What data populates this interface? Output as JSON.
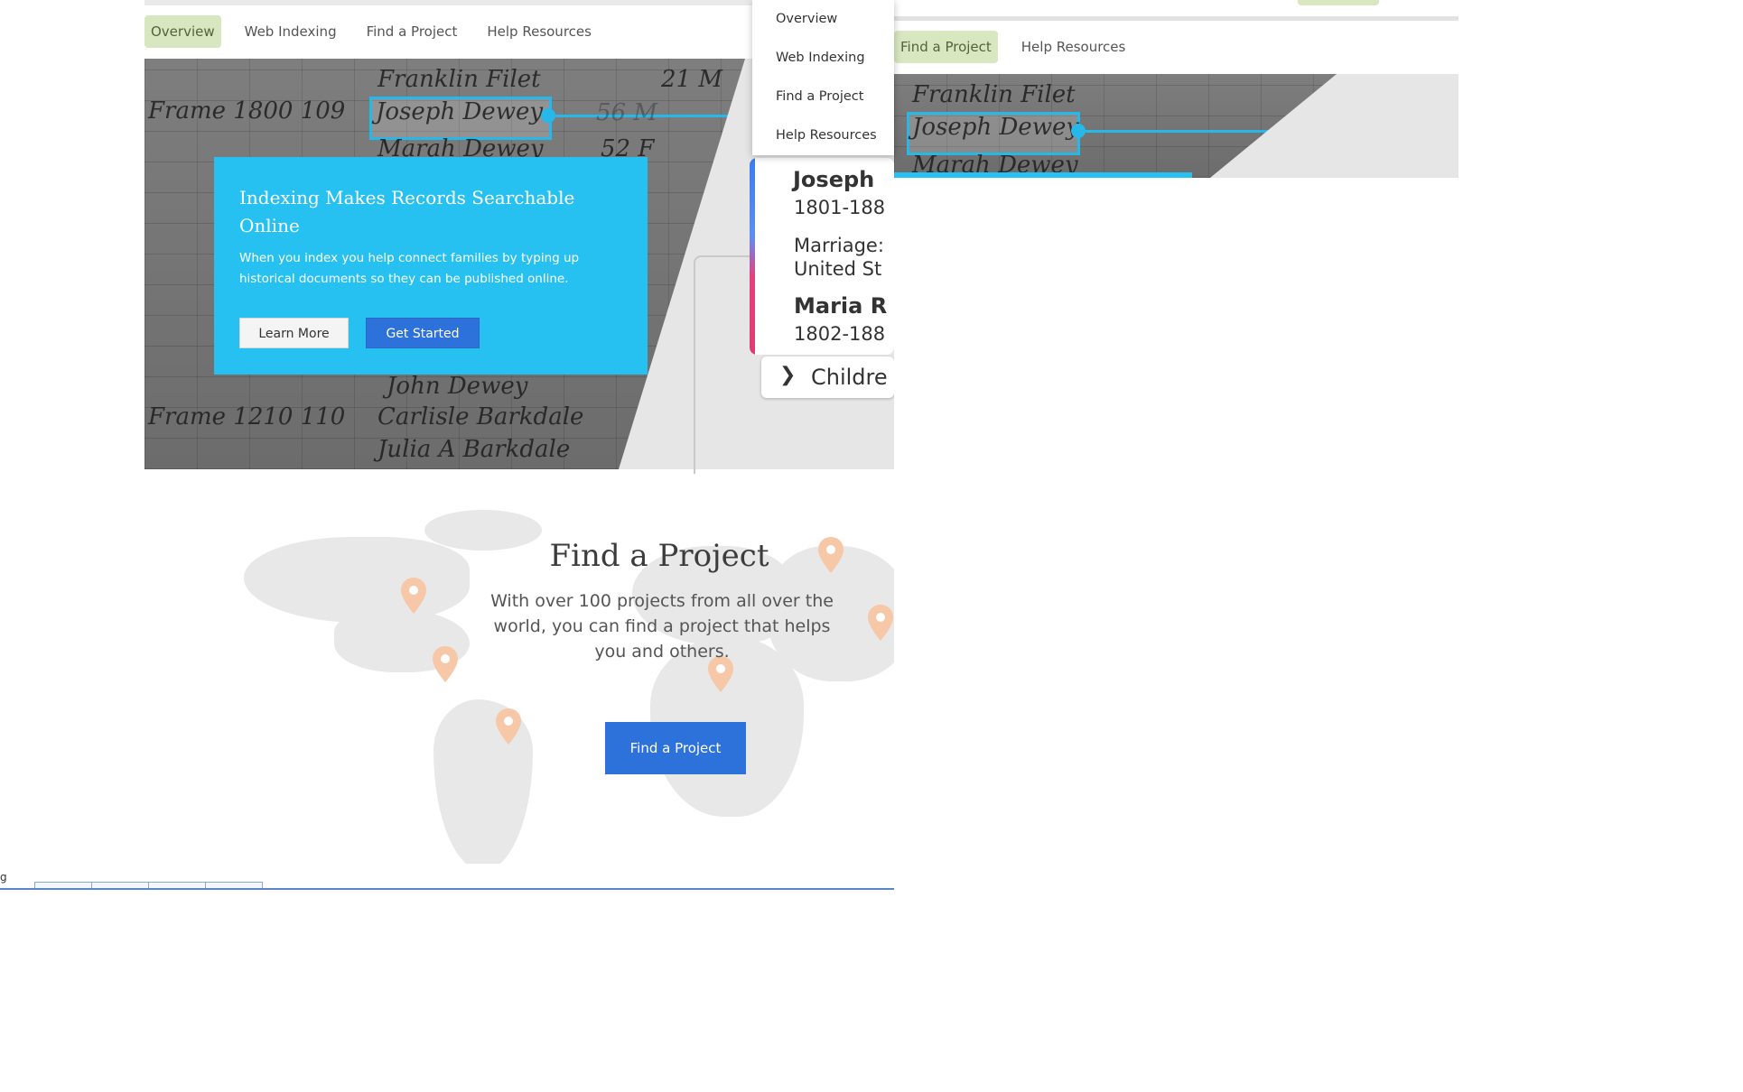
{
  "nav": {
    "items": [
      {
        "label": "Overview",
        "active": true
      },
      {
        "label": "Web Indexing",
        "active": false
      },
      {
        "label": "Find a Project",
        "active": false
      },
      {
        "label": "Help Resources",
        "active": false
      }
    ]
  },
  "dropdown": {
    "items": [
      "Overview",
      "Web Indexing",
      "Find a Project",
      "Help Resources"
    ]
  },
  "hero": {
    "handwriting": {
      "line1": "Franklin Filet",
      "line1_age": "21 M",
      "line2_prefix": "Frame 1800  109",
      "line2_name": "Joseph Dewey",
      "line2_age": "56 M",
      "line3": "Marah Dewey",
      "line3_age": "52 F",
      "line4": "John Dewey",
      "line5_prefix": "Frame 1210  110",
      "line5_name": "Carlisle Barkdale",
      "line6": "Julia A Barkdale"
    },
    "promo": {
      "title": "Indexing Makes Records Searchable Online",
      "text": "When you index you help connect families by typing up historical documents so they can be published online.",
      "learn_more": "Learn More",
      "get_started": "Get Started"
    },
    "tree": {
      "person1_name": "Joseph",
      "person1_years": "1801-188",
      "marriage_label": "Marriage:",
      "marriage_place": "United St",
      "person2_name": "Maria R",
      "person2_years": "1802-188",
      "children_label": "Childre"
    }
  },
  "find_project": {
    "title": "Find a Project",
    "text": "With over 100 projects from all over the world, you can find a project that helps you and others.",
    "button": "Find a Project"
  },
  "statusbar": {
    "text": "g"
  },
  "fragment": {
    "nav": [
      {
        "label": "Find a Project",
        "active": true
      },
      {
        "label": "Help Resources",
        "active": false
      }
    ]
  },
  "colors": {
    "accent_blue": "#27c1f1",
    "button_blue": "#2d72da",
    "nav_active_bg": "#d9e7c0",
    "pin_color": "#f6c8a8"
  }
}
